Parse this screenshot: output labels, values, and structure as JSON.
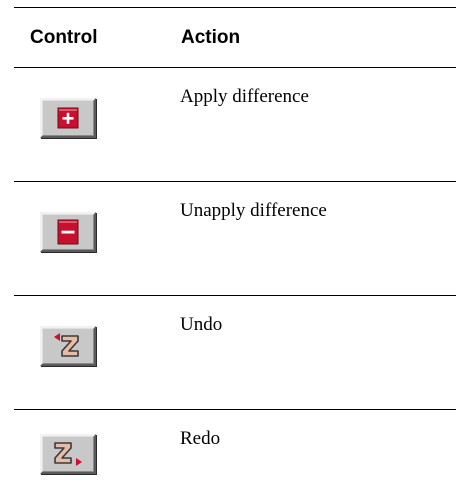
{
  "header": {
    "control_label": "Control",
    "action_label": "Action"
  },
  "rows": [
    {
      "icon": "plus-icon",
      "action": "Apply difference"
    },
    {
      "icon": "minus-icon",
      "action": "Unapply difference"
    },
    {
      "icon": "undo-icon",
      "action": "Undo"
    },
    {
      "icon": "redo-icon",
      "action": "Redo"
    }
  ],
  "colors": {
    "accent_red": "#c8102e",
    "button_face": "#c8c8c8",
    "z_glyph": "#e6b8a2"
  }
}
